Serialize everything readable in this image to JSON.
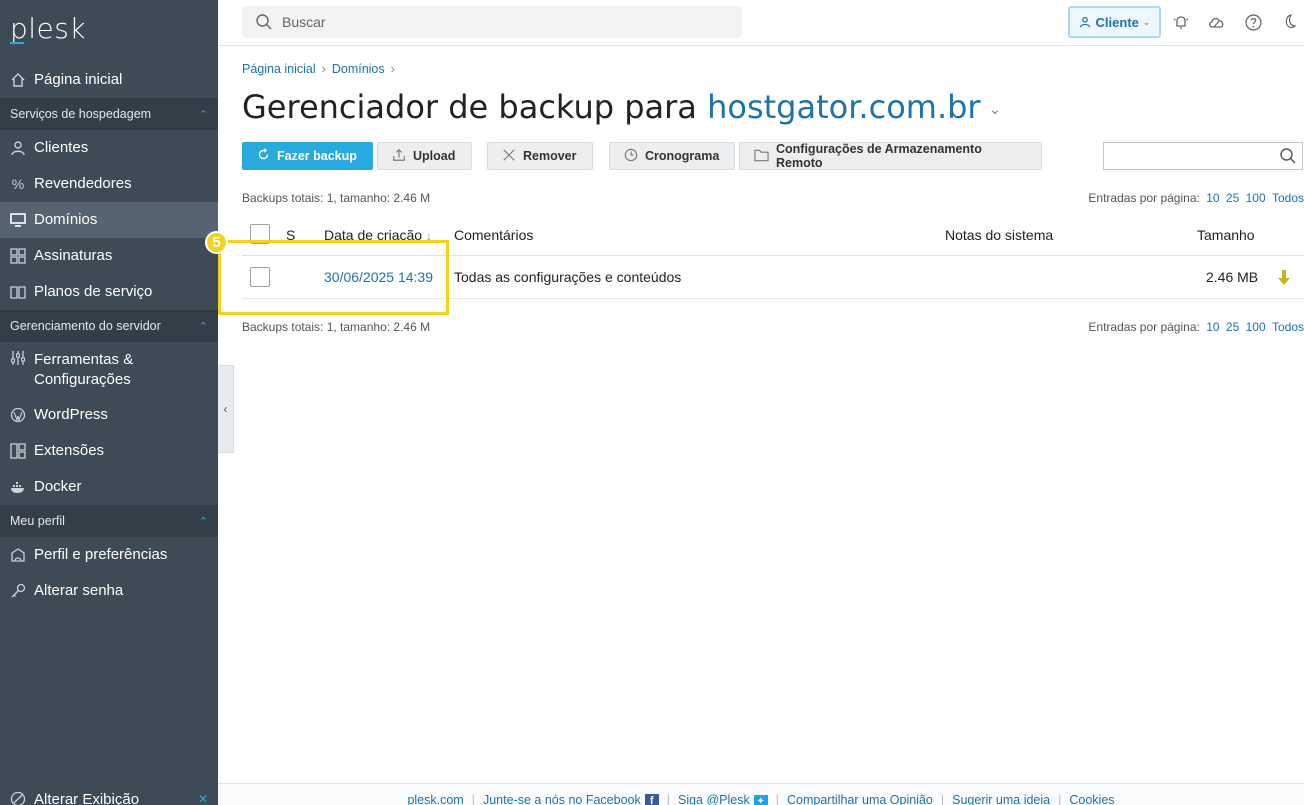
{
  "sidebar": {
    "logo": "plesk",
    "items": [
      {
        "label": "Página inicial",
        "icon": "home-icon"
      },
      {
        "group": "Serviços de hospedagem"
      },
      {
        "label": "Clientes",
        "icon": "user-icon"
      },
      {
        "label": "Revendedores",
        "icon": "percent-icon"
      },
      {
        "label": "Domínios",
        "icon": "monitor-icon",
        "active": true
      },
      {
        "label": "Assinaturas",
        "icon": "grid-icon"
      },
      {
        "label": "Planos de serviço",
        "icon": "book-icon"
      },
      {
        "group": "Gerenciamento do servidor"
      },
      {
        "label": "Ferramentas & Configurações",
        "icon": "sliders-icon"
      },
      {
        "label": "WordPress",
        "icon": "wordpress-icon"
      },
      {
        "label": "Extensões",
        "icon": "extensions-icon"
      },
      {
        "label": "Docker",
        "icon": "docker-icon"
      },
      {
        "group": "Meu perfil"
      },
      {
        "label": "Perfil e preferências",
        "icon": "profile-icon"
      },
      {
        "label": "Alterar senha",
        "icon": "key-icon"
      }
    ],
    "groups": {
      "hosting": "Serviços de hospedagem",
      "server": "Gerenciamento do servidor",
      "profile": "Meu perfil"
    },
    "labels": {
      "home": "Página inicial",
      "clients": "Clientes",
      "resellers": "Revendedores",
      "domains": "Domínios",
      "subscriptions": "Assinaturas",
      "plans": "Planos de serviço",
      "tools_1": "Ferramentas &",
      "tools_2": "Configurações",
      "wordpress": "WordPress",
      "extensions": "Extensões",
      "docker": "Docker",
      "profile": "Perfil e preferências",
      "password": "Alterar senha"
    },
    "bottom": "Alterar Exibição"
  },
  "topbar": {
    "search_placeholder": "Buscar",
    "role": "Cliente"
  },
  "breadcrumb": [
    "Página inicial",
    "Domínios"
  ],
  "title": {
    "prefix": "Gerenciador de backup para",
    "domain": "hostgator.com.br"
  },
  "toolbar": {
    "backup": "Fazer backup",
    "upload": "Upload",
    "remove": "Remover",
    "schedule": "Cronograma",
    "remote": "Configurações de Armazenamento Remoto"
  },
  "totals": "Backups totais: 1, tamanho: 2.46 M",
  "per_page": {
    "label": "Entradas por página:",
    "options": [
      "10",
      "25",
      "100",
      "Todos"
    ]
  },
  "table": {
    "headers": {
      "s": "S",
      "date": "Data de criação",
      "comments": "Comentários",
      "notes": "Notas do sistema",
      "size": "Tamanho"
    },
    "rows": [
      {
        "date": "30/06/2025 14:39",
        "comments": "Todas as configurações e conteúdos",
        "notes": "",
        "size": "2.46 MB"
      }
    ]
  },
  "annotation": {
    "step": "5"
  },
  "footer": {
    "links": [
      "plesk.com",
      "Junte-se a nós no Facebook",
      "Siga @Plesk",
      "Compartilhar uma Opinião",
      "Sugerir uma ideia",
      "Cookies"
    ]
  },
  "colors": {
    "sidebar_bg": "#3e4a56",
    "accent": "#28aade",
    "link": "#1e73a8",
    "highlight": "#f5d21c"
  }
}
